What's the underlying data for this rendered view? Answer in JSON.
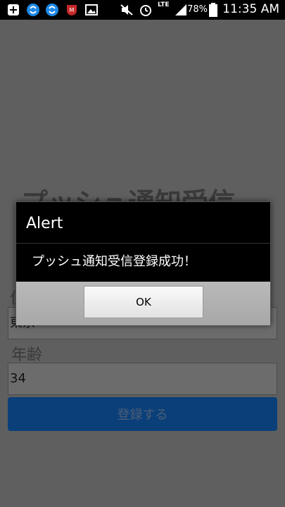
{
  "status_bar": {
    "lte": "LTE",
    "battery": "78%",
    "time": "11:35 AM",
    "icons": [
      "plus-icon",
      "sync-icon",
      "sync-icon",
      "mcafee-icon",
      "image-icon",
      "mute-icon",
      "alarm-icon",
      "signal-icon",
      "battery-icon"
    ]
  },
  "page": {
    "title": "プッシュ通知受信登録",
    "field1_label": "住",
    "field1_value": "東京",
    "age_label": "年齢",
    "age_value": "34",
    "submit_label": "登録する"
  },
  "dialog": {
    "title": "Alert",
    "message": "プッシュ通知受信登録成功！",
    "ok_label": "OK"
  }
}
